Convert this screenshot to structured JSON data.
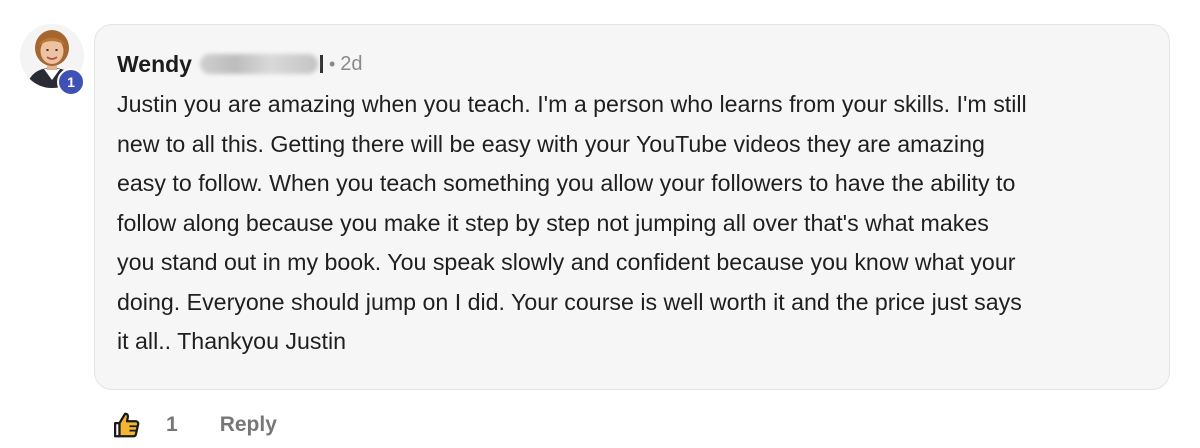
{
  "comment": {
    "author_name": "Wendy",
    "level": "1",
    "separator": "•",
    "timestamp": "2d",
    "text": "Justin you are amazing when you teach. I'm a person who learns from your skills. I'm still\nnew to all this. Getting there will be easy with your YouTube videos they are amazing\neasy to follow. When you teach something you allow your followers to have the ability to\nfollow along because you make it step by step not jumping all over that's what makes\nyou stand out in my book. You speak slowly and confident because you know what your\ndoing. Everyone should jump on I did. Your course is well worth it and the price just says\nit all.. Thankyou Justin",
    "like_count": "1",
    "reply_label": "Reply"
  },
  "colors": {
    "bubble_bg": "#f6f6f6",
    "badge": "#3f51b5",
    "muted_text": "#777777"
  },
  "icons": {
    "like": "thumbs-up-icon"
  }
}
